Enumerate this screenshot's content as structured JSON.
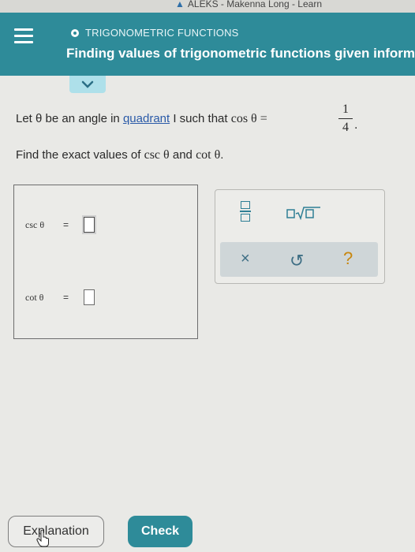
{
  "window": {
    "title": "ALEKS - Makenna Long - Learn"
  },
  "header": {
    "topic": "TRIGONOMETRIC FUNCTIONS",
    "title": "Finding values of trigonometric functions given inform"
  },
  "problem": {
    "text1": "Let θ be an angle in ",
    "link": "quadrant",
    "text2": " I such that ",
    "expr": "cos θ = ",
    "frac_num": "1",
    "frac_den": "4",
    "period": ".",
    "find_text": "Find the exact values of ",
    "find_csc": "csc θ",
    "find_and": " and ",
    "find_cot": "cot θ",
    "find_end": "."
  },
  "answers": [
    {
      "label": "csc θ",
      "eq": "=",
      "value": ""
    },
    {
      "label": "cot θ",
      "eq": "=",
      "value": ""
    }
  ],
  "tools": {
    "clear": "×",
    "undo": "↺",
    "help": "?"
  },
  "buttons": {
    "explanation": "Explanation",
    "check": "Check"
  },
  "colors": {
    "header": "#2e8b99",
    "link": "#2a5aa8",
    "help": "#c8870f"
  }
}
